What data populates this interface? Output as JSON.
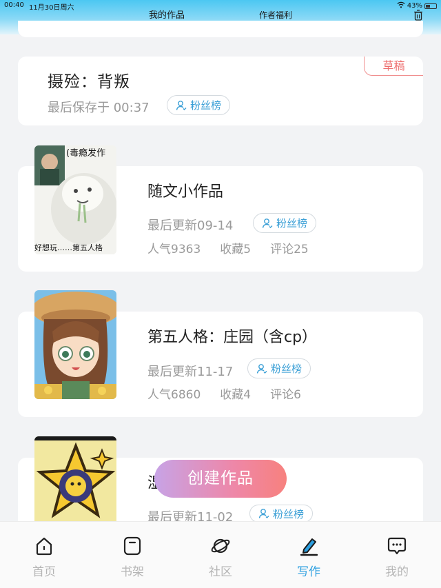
{
  "status": {
    "time": "00:40",
    "date": "11月30日周六",
    "battery": "43%"
  },
  "header": {
    "tab_works": "我的作品",
    "tab_benefits": "作者福利"
  },
  "draft": {
    "title": "摄殓：背叛",
    "saved": "最后保存于 00:37",
    "tag": "草稿",
    "fan_label": "粉丝榜"
  },
  "works": [
    {
      "title": "随文小作品",
      "updated": "最后更新09-14",
      "fan_label": "粉丝榜",
      "popularity": "人气9363",
      "favorites": "收藏5",
      "comments": "评论25",
      "cover_text_top": "(毒瘾发作",
      "cover_text_bottom": "好想玩……第五人格"
    },
    {
      "title": "第五人格：庄园（含cp）",
      "updated": "最后更新11-17",
      "fan_label": "粉丝榜",
      "popularity": "人气6860",
      "favorites": "收藏4",
      "comments": "评论6"
    },
    {
      "title": "湿",
      "updated": "最后更新11-02",
      "fan_label": "粉丝榜"
    }
  ],
  "create_button": "创建作品",
  "nav": [
    {
      "label": "首页",
      "icon": "home-icon"
    },
    {
      "label": "书架",
      "icon": "bookshelf-icon"
    },
    {
      "label": "社区",
      "icon": "planet-icon"
    },
    {
      "label": "写作",
      "icon": "pen-icon"
    },
    {
      "label": "我的",
      "icon": "chat-bubble-icon"
    }
  ],
  "colors": {
    "accent": "#2b9fe0",
    "draft_tag": "#ee6f6f"
  }
}
